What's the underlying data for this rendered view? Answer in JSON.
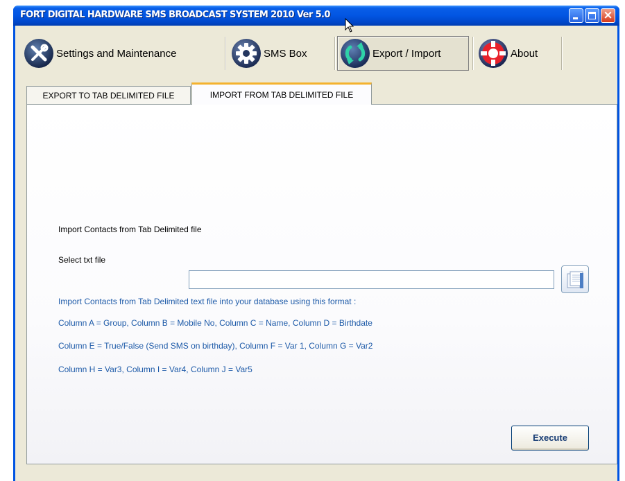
{
  "window": {
    "title": "FORT DIGITAL HARDWARE SMS BROADCAST SYSTEM 2010 Ver 5.0",
    "controls": {
      "minimize": "_",
      "maximize": "□",
      "close": "X"
    }
  },
  "toolbar": {
    "settings_label": "Settings and Maintenance",
    "smsbox_label": "SMS Box",
    "export_import_label": "Export / Import",
    "about_label": "About"
  },
  "tabs": {
    "export_label": "EXPORT TO TAB DELIMITED FILE",
    "import_label": "IMPORT FROM TAB DELIMITED FILE"
  },
  "import_panel": {
    "heading": "Import Contacts from Tab Delimited file",
    "select_label": "Select txt file",
    "file_value": "",
    "format_intro": "Import Contacts from Tab Delimited text file into your database using this format :",
    "format_line1": "Column A = Group, Column B = Mobile No, Column C =  Name, Column D = Birthdate",
    "format_line2": "Column E = True/False (Send SMS on birthday), Column F = Var 1, Column G =  Var2",
    "format_line3": "Column H = Var3, Column I = Var4, Column J = Var5",
    "execute_label": "Execute"
  },
  "icons": {
    "settings": "wrench-screwdriver-icon",
    "smsbox": "gear-icon",
    "export_import": "refresh-arrows-icon",
    "about": "lifebuoy-icon",
    "browse": "folder-browse-icon"
  },
  "colors": {
    "titlebar": "#0054e3",
    "tab_active_accent": "#f4b22e",
    "format_text": "#1d5aa8",
    "execute_text": "#163b73"
  }
}
